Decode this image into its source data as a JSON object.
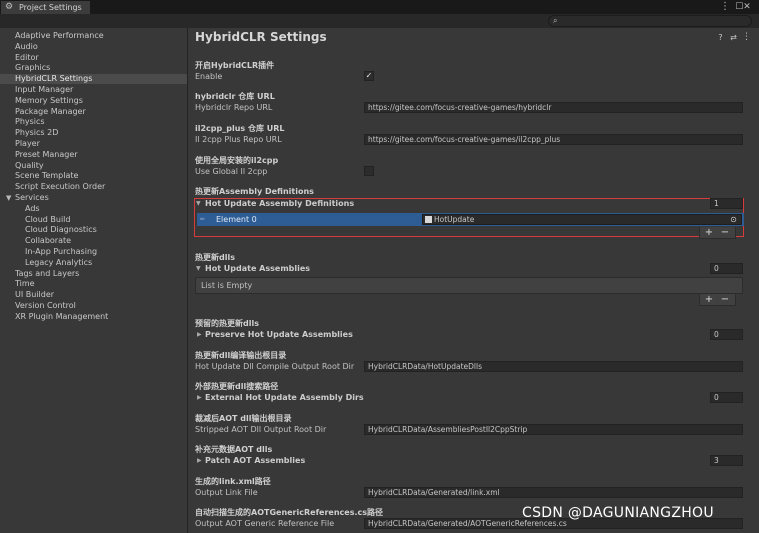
{
  "window": {
    "tab_title": "Project Settings",
    "tab_icon": "gear-icon"
  },
  "search": {
    "placeholder": ""
  },
  "sidebar": {
    "items": [
      {
        "label": "Adaptive Performance",
        "indent": false
      },
      {
        "label": "Audio",
        "indent": false
      },
      {
        "label": "Editor",
        "indent": false
      },
      {
        "label": "Graphics",
        "indent": false
      },
      {
        "label": "HybridCLR Settings",
        "indent": false,
        "selected": true
      },
      {
        "label": "Input Manager",
        "indent": false
      },
      {
        "label": "Memory Settings",
        "indent": false
      },
      {
        "label": "Package Manager",
        "indent": false
      },
      {
        "label": "Physics",
        "indent": false
      },
      {
        "label": "Physics 2D",
        "indent": false
      },
      {
        "label": "Player",
        "indent": false
      },
      {
        "label": "Preset Manager",
        "indent": false
      },
      {
        "label": "Quality",
        "indent": false
      },
      {
        "label": "Scene Template",
        "indent": false
      },
      {
        "label": "Script Execution Order",
        "indent": false
      },
      {
        "label": "Services",
        "indent": false,
        "expanded": true
      },
      {
        "label": "Ads",
        "indent": true
      },
      {
        "label": "Cloud Build",
        "indent": true
      },
      {
        "label": "Cloud Diagnostics",
        "indent": true
      },
      {
        "label": "Collaborate",
        "indent": true
      },
      {
        "label": "In-App Purchasing",
        "indent": true
      },
      {
        "label": "Legacy Analytics",
        "indent": true
      },
      {
        "label": "Tags and Layers",
        "indent": false
      },
      {
        "label": "Time",
        "indent": false
      },
      {
        "label": "UI Builder",
        "indent": false
      },
      {
        "label": "Version Control",
        "indent": false
      },
      {
        "label": "XR Plugin Management",
        "indent": false
      }
    ]
  },
  "main": {
    "title": "HybridCLR Settings",
    "enable": {
      "header": "开启HybridCLR插件",
      "label": "Enable",
      "checked": true
    },
    "repo_url": {
      "header": "hybridclr 仓库 URL",
      "label": "Hybridclr Repo URL",
      "value": "https://gitee.com/focus-creative-games/hybridclr"
    },
    "il2cpp_plus_url": {
      "header": "il2cpp_plus 仓库 URL",
      "label": "Il 2cpp Plus Repo URL",
      "value": "https://gitee.com/focus-creative-games/il2cpp_plus"
    },
    "global_il2cpp": {
      "header": "使用全局安装的il2cpp",
      "label": "Use Global Il 2cpp",
      "checked": false
    },
    "hot_update_asm_defs": {
      "header": "热更新Assembly Definitions",
      "label": "Hot Update Assembly Definitions",
      "count": "1",
      "element_label": "Element 0",
      "element_value": "HotUpdate"
    },
    "hot_update_dlls": {
      "header": "热更新dlls",
      "label": "Hot Update Assemblies",
      "count": "0",
      "empty_text": "List is Empty"
    },
    "preserve_dlls": {
      "header": "预留的热更新dlls",
      "label": "Preserve Hot Update Assemblies",
      "count": "0"
    },
    "compile_output": {
      "header": "热更新dll编译输出根目录",
      "label": "Hot Update Dll Compile Output Root Dir",
      "value": "HybridCLRData/HotUpdateDlls"
    },
    "external_dirs": {
      "header": "外部热更新dll搜索路径",
      "label": "External Hot Update Assembly Dirs",
      "count": "0"
    },
    "stripped_aot": {
      "header": "裁减后AOT dll输出根目录",
      "label": "Stripped AOT Dll Output Root Dir",
      "value": "HybridCLRData/AssembliesPostIl2CppStrip"
    },
    "patch_aot": {
      "header": "补充元数据AOT dlls",
      "label": "Patch AOT Assemblies",
      "count": "3"
    },
    "link_xml": {
      "header": "生成的link.xml路径",
      "label": "Output Link File",
      "value": "HybridCLRData/Generated/link.xml"
    },
    "aot_generic": {
      "header": "自动扫描生成的AOTGenericReferences.cs路径",
      "label": "Output AOT Generic Reference File",
      "value": "HybridCLRData/Generated/AOTGenericReferences.cs"
    }
  },
  "watermark": "CSDN @DAGUNIANGZHOU"
}
